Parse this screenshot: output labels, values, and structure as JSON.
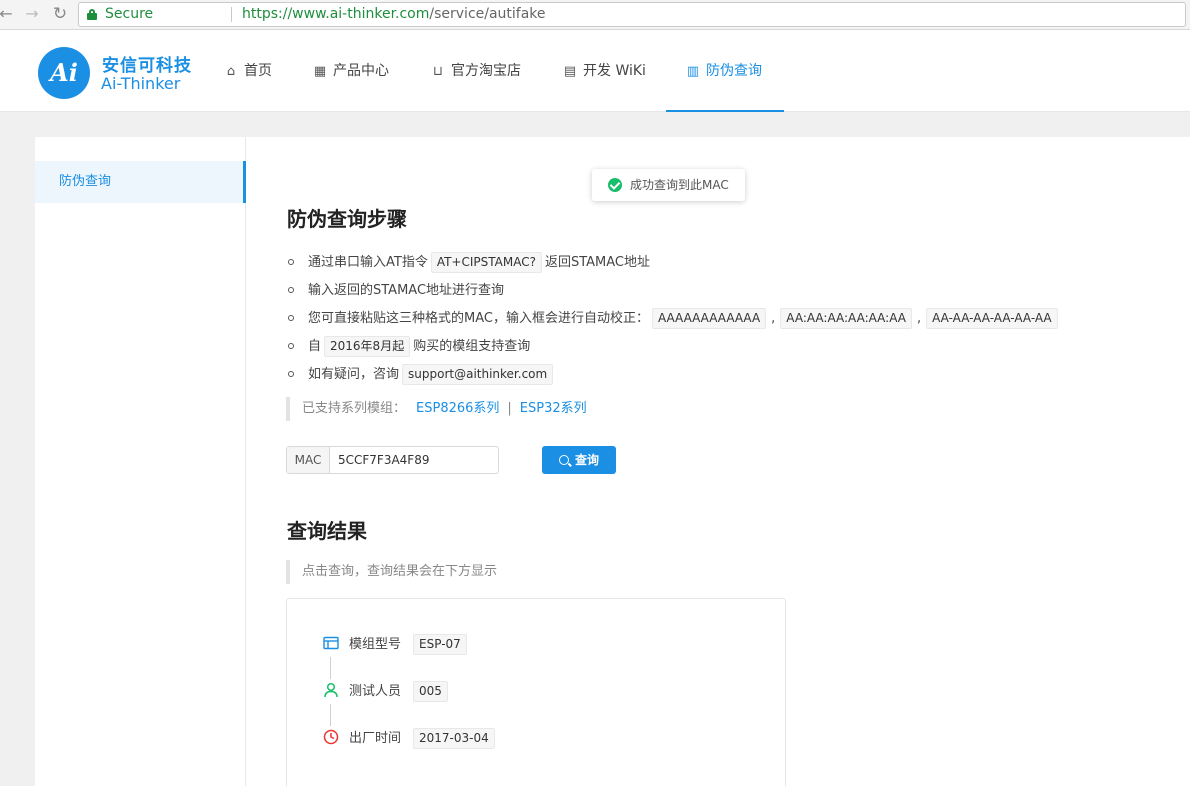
{
  "browser": {
    "secure_label": "Secure",
    "url_host": "https://www.ai-thinker.com",
    "url_path": "/service/autifake"
  },
  "header": {
    "logo_text": "Ai",
    "logo_cn": "安信可科技",
    "logo_en": "Ai-Thinker",
    "nav": [
      {
        "label": "首页",
        "icon": "home-icon"
      },
      {
        "label": "产品中心",
        "icon": "grid-icon"
      },
      {
        "label": "官方淘宝店",
        "icon": "cart-icon"
      },
      {
        "label": "开发 WiKi",
        "icon": "document-icon"
      },
      {
        "label": "防伪查询",
        "icon": "barcode-icon",
        "active": true
      }
    ]
  },
  "sidebar": {
    "items": [
      {
        "label": "防伪查询",
        "active": true
      }
    ]
  },
  "toast": {
    "message": "成功查询到此MAC"
  },
  "steps": {
    "title": "防伪查询步骤",
    "items": [
      {
        "pre": "通过串口输入AT指令",
        "code": "AT+CIPSTAMAC?",
        "post": "返回STAMAC地址"
      },
      {
        "pre": "输入返回的STAMAC地址进行查询"
      },
      {
        "pre": "您可直接粘贴这三种格式的MAC，输入框会进行自动校正：",
        "codes": [
          "AAAAAAAAAAAA",
          "AA:AA:AA:AA:AA:AA",
          "AA-AA-AA-AA-AA-AA"
        ]
      },
      {
        "pre": "自",
        "code": "2016年8月起",
        "post": "购买的模组支持查询"
      },
      {
        "pre": "如有疑问，咨询",
        "code": "support@aithinker.com"
      }
    ],
    "supported_label": "已支持系列模组：",
    "supported_links": [
      "ESP8266系列",
      "ESP32系列"
    ],
    "link_sep": "|"
  },
  "query": {
    "mac_label": "MAC",
    "mac_value": "5CCF7F3A4F89",
    "button_label": "查询"
  },
  "result": {
    "title": "查询结果",
    "hint": "点击查询，查询结果会在下方显示",
    "rows": [
      {
        "label": "模组型号",
        "value": "ESP-07",
        "icon": "module-icon"
      },
      {
        "label": "测试人员",
        "value": "005",
        "icon": "person-icon"
      },
      {
        "label": "出厂时间",
        "value": "2017-03-04",
        "icon": "clock-icon"
      }
    ]
  },
  "colors": {
    "accent": "#1a8fe3",
    "success": "#19be6b",
    "secure": "#1e8e3e"
  }
}
